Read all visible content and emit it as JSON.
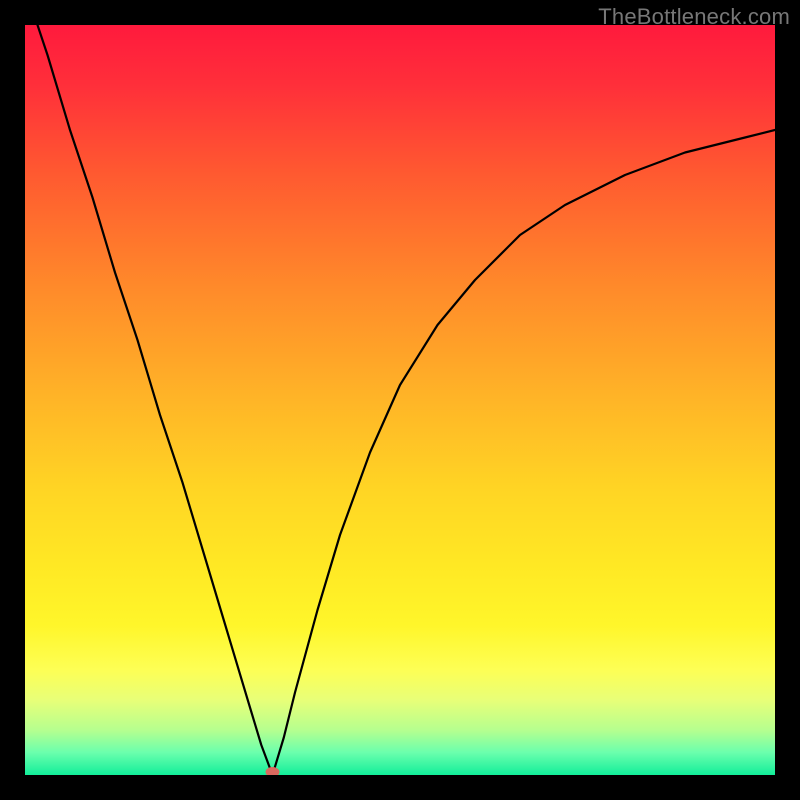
{
  "watermark": "TheBottleneck.com",
  "chart_data": {
    "type": "line",
    "title": "",
    "xlabel": "",
    "ylabel": "",
    "xlim": [
      0,
      100
    ],
    "ylim": [
      0,
      100
    ],
    "grid": false,
    "legend": false,
    "marker": {
      "x": 33,
      "y": 0,
      "color": "#d9695f",
      "radius": 6
    },
    "series": [
      {
        "name": "bottleneck-curve",
        "color": "#000000",
        "x": [
          0,
          3,
          6,
          9,
          12,
          15,
          18,
          21,
          24,
          27,
          30,
          31.5,
          33,
          34.5,
          36,
          39,
          42,
          46,
          50,
          55,
          60,
          66,
          72,
          80,
          88,
          96,
          100
        ],
        "y": [
          105,
          96,
          86,
          77,
          67,
          58,
          48,
          39,
          29,
          19,
          9,
          4,
          0,
          5,
          11,
          22,
          32,
          43,
          52,
          60,
          66,
          72,
          76,
          80,
          83,
          85,
          86
        ]
      }
    ],
    "background_gradient": {
      "type": "vertical",
      "stops": [
        {
          "offset": 0,
          "color": "#ff1a3d"
        },
        {
          "offset": 0.08,
          "color": "#ff2f3a"
        },
        {
          "offset": 0.2,
          "color": "#ff5a30"
        },
        {
          "offset": 0.35,
          "color": "#ff8a2a"
        },
        {
          "offset": 0.5,
          "color": "#ffb527"
        },
        {
          "offset": 0.62,
          "color": "#ffd524"
        },
        {
          "offset": 0.72,
          "color": "#ffe824"
        },
        {
          "offset": 0.8,
          "color": "#fff62a"
        },
        {
          "offset": 0.86,
          "color": "#fdff55"
        },
        {
          "offset": 0.9,
          "color": "#e8ff78"
        },
        {
          "offset": 0.94,
          "color": "#b6ff8f"
        },
        {
          "offset": 0.97,
          "color": "#6bffad"
        },
        {
          "offset": 1.0,
          "color": "#12ee9a"
        }
      ]
    }
  }
}
